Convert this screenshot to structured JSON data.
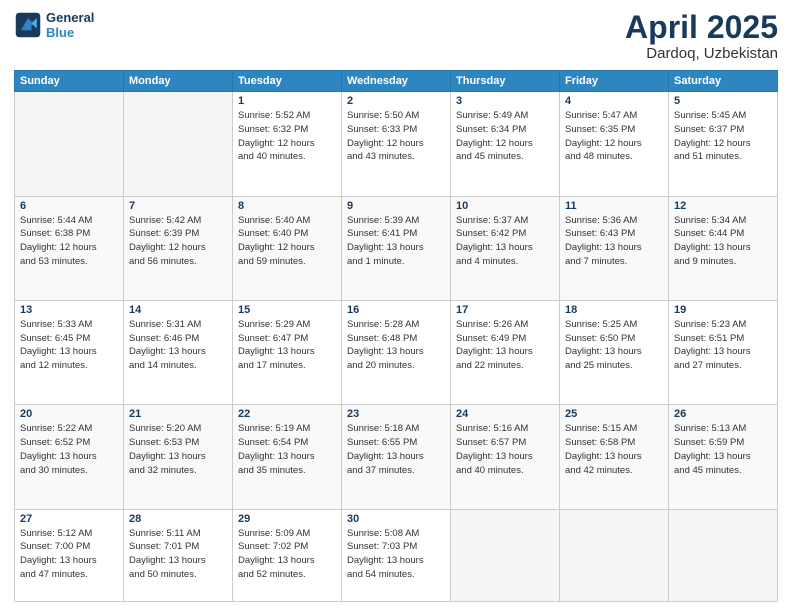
{
  "header": {
    "logo_line1": "General",
    "logo_line2": "Blue",
    "month": "April 2025",
    "location": "Dardoq, Uzbekistan"
  },
  "weekdays": [
    "Sunday",
    "Monday",
    "Tuesday",
    "Wednesday",
    "Thursday",
    "Friday",
    "Saturday"
  ],
  "weeks": [
    [
      {
        "day": "",
        "info": ""
      },
      {
        "day": "",
        "info": ""
      },
      {
        "day": "1",
        "info": "Sunrise: 5:52 AM\nSunset: 6:32 PM\nDaylight: 12 hours\nand 40 minutes."
      },
      {
        "day": "2",
        "info": "Sunrise: 5:50 AM\nSunset: 6:33 PM\nDaylight: 12 hours\nand 43 minutes."
      },
      {
        "day": "3",
        "info": "Sunrise: 5:49 AM\nSunset: 6:34 PM\nDaylight: 12 hours\nand 45 minutes."
      },
      {
        "day": "4",
        "info": "Sunrise: 5:47 AM\nSunset: 6:35 PM\nDaylight: 12 hours\nand 48 minutes."
      },
      {
        "day": "5",
        "info": "Sunrise: 5:45 AM\nSunset: 6:37 PM\nDaylight: 12 hours\nand 51 minutes."
      }
    ],
    [
      {
        "day": "6",
        "info": "Sunrise: 5:44 AM\nSunset: 6:38 PM\nDaylight: 12 hours\nand 53 minutes."
      },
      {
        "day": "7",
        "info": "Sunrise: 5:42 AM\nSunset: 6:39 PM\nDaylight: 12 hours\nand 56 minutes."
      },
      {
        "day": "8",
        "info": "Sunrise: 5:40 AM\nSunset: 6:40 PM\nDaylight: 12 hours\nand 59 minutes."
      },
      {
        "day": "9",
        "info": "Sunrise: 5:39 AM\nSunset: 6:41 PM\nDaylight: 13 hours\nand 1 minute."
      },
      {
        "day": "10",
        "info": "Sunrise: 5:37 AM\nSunset: 6:42 PM\nDaylight: 13 hours\nand 4 minutes."
      },
      {
        "day": "11",
        "info": "Sunrise: 5:36 AM\nSunset: 6:43 PM\nDaylight: 13 hours\nand 7 minutes."
      },
      {
        "day": "12",
        "info": "Sunrise: 5:34 AM\nSunset: 6:44 PM\nDaylight: 13 hours\nand 9 minutes."
      }
    ],
    [
      {
        "day": "13",
        "info": "Sunrise: 5:33 AM\nSunset: 6:45 PM\nDaylight: 13 hours\nand 12 minutes."
      },
      {
        "day": "14",
        "info": "Sunrise: 5:31 AM\nSunset: 6:46 PM\nDaylight: 13 hours\nand 14 minutes."
      },
      {
        "day": "15",
        "info": "Sunrise: 5:29 AM\nSunset: 6:47 PM\nDaylight: 13 hours\nand 17 minutes."
      },
      {
        "day": "16",
        "info": "Sunrise: 5:28 AM\nSunset: 6:48 PM\nDaylight: 13 hours\nand 20 minutes."
      },
      {
        "day": "17",
        "info": "Sunrise: 5:26 AM\nSunset: 6:49 PM\nDaylight: 13 hours\nand 22 minutes."
      },
      {
        "day": "18",
        "info": "Sunrise: 5:25 AM\nSunset: 6:50 PM\nDaylight: 13 hours\nand 25 minutes."
      },
      {
        "day": "19",
        "info": "Sunrise: 5:23 AM\nSunset: 6:51 PM\nDaylight: 13 hours\nand 27 minutes."
      }
    ],
    [
      {
        "day": "20",
        "info": "Sunrise: 5:22 AM\nSunset: 6:52 PM\nDaylight: 13 hours\nand 30 minutes."
      },
      {
        "day": "21",
        "info": "Sunrise: 5:20 AM\nSunset: 6:53 PM\nDaylight: 13 hours\nand 32 minutes."
      },
      {
        "day": "22",
        "info": "Sunrise: 5:19 AM\nSunset: 6:54 PM\nDaylight: 13 hours\nand 35 minutes."
      },
      {
        "day": "23",
        "info": "Sunrise: 5:18 AM\nSunset: 6:55 PM\nDaylight: 13 hours\nand 37 minutes."
      },
      {
        "day": "24",
        "info": "Sunrise: 5:16 AM\nSunset: 6:57 PM\nDaylight: 13 hours\nand 40 minutes."
      },
      {
        "day": "25",
        "info": "Sunrise: 5:15 AM\nSunset: 6:58 PM\nDaylight: 13 hours\nand 42 minutes."
      },
      {
        "day": "26",
        "info": "Sunrise: 5:13 AM\nSunset: 6:59 PM\nDaylight: 13 hours\nand 45 minutes."
      }
    ],
    [
      {
        "day": "27",
        "info": "Sunrise: 5:12 AM\nSunset: 7:00 PM\nDaylight: 13 hours\nand 47 minutes."
      },
      {
        "day": "28",
        "info": "Sunrise: 5:11 AM\nSunset: 7:01 PM\nDaylight: 13 hours\nand 50 minutes."
      },
      {
        "day": "29",
        "info": "Sunrise: 5:09 AM\nSunset: 7:02 PM\nDaylight: 13 hours\nand 52 minutes."
      },
      {
        "day": "30",
        "info": "Sunrise: 5:08 AM\nSunset: 7:03 PM\nDaylight: 13 hours\nand 54 minutes."
      },
      {
        "day": "",
        "info": ""
      },
      {
        "day": "",
        "info": ""
      },
      {
        "day": "",
        "info": ""
      }
    ]
  ]
}
